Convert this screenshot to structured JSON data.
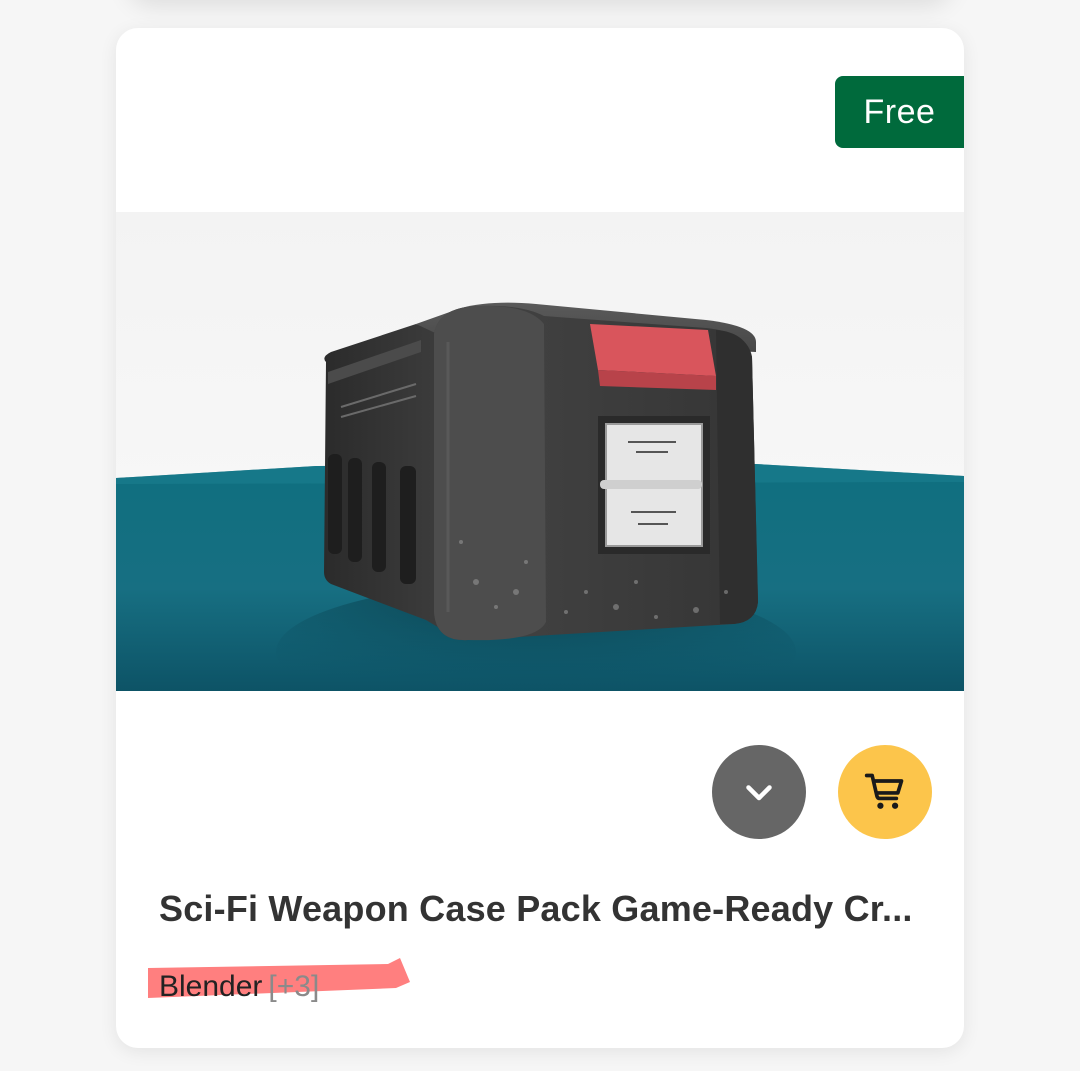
{
  "product": {
    "price_label": "Free",
    "title": "Sci-Fi Weapon Case Pack Game-Ready Cr...",
    "image_alt": "Sci-Fi Weapon Case 3D model",
    "software": "Blender",
    "extra_formats": "[+3]"
  },
  "actions": {
    "expand_icon": "chevron-down-icon",
    "cart_icon": "shopping-cart-icon"
  },
  "colors": {
    "badge": "#006a3c",
    "expand_button": "#666666",
    "cart_button": "#fcc54b",
    "highlight": "#ff7f7f"
  }
}
